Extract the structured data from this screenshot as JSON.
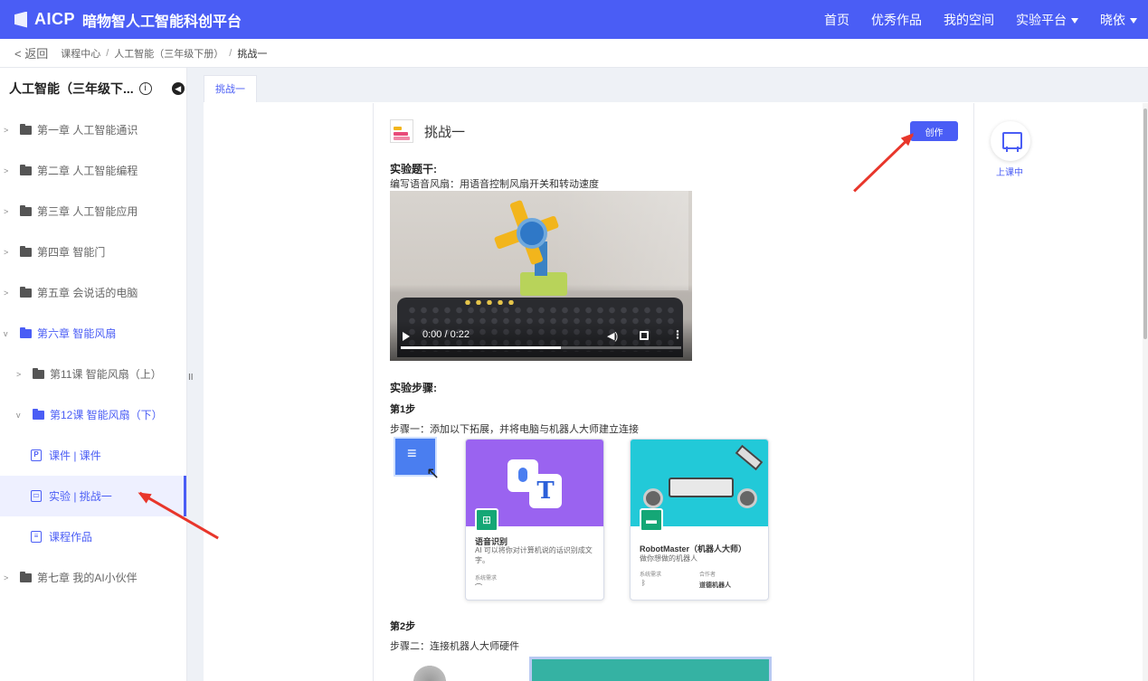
{
  "header": {
    "logo": "AICP",
    "platform_name": "暗物智人工智能科创平台",
    "nav": [
      {
        "label": "首页"
      },
      {
        "label": "优秀作品"
      },
      {
        "label": "我的空间"
      },
      {
        "label": "实验平台",
        "dropdown": true
      },
      {
        "label": "晓依",
        "dropdown": true
      }
    ]
  },
  "breadcrumb": {
    "back": "< 返回",
    "items": [
      "课程中心",
      "人工智能（三年级下册）",
      "挑战一"
    ]
  },
  "sidebar": {
    "title": "人工智能（三年级下...",
    "chapters": [
      {
        "label": "第一章 人工智能通识"
      },
      {
        "label": "第二章 人工智能编程"
      },
      {
        "label": "第三章 人工智能应用"
      },
      {
        "label": "第四章 智能门"
      },
      {
        "label": "第五章 会说话的电脑"
      },
      {
        "label": "第六章 智能风扇"
      }
    ],
    "lessons": [
      {
        "label": "第11课 智能风扇（上）"
      },
      {
        "label": "第12课 智能风扇（下）"
      }
    ],
    "leaves": [
      {
        "label": "课件 | 课件",
        "icon": "P"
      },
      {
        "label": "实验 | 挑战一",
        "icon": "▭"
      },
      {
        "label": "课程作品",
        "icon": "≡"
      }
    ],
    "last_chapter": "第七章 我的AI小伙伴"
  },
  "tabs": [
    {
      "label": "挑战一"
    }
  ],
  "task": {
    "title": "挑战一",
    "create_button": "创作",
    "stem_label": "实验题干:",
    "stem_text": "编写语音风扇：用语音控制风扇开关和转动速度",
    "video": {
      "time": "0:00 / 0:22",
      "progress": 0.57
    },
    "steps_label": "实验步骤:",
    "step1_label": "第1步",
    "step1_text": "步骤一：添加以下拓展，并将电脑与机器人大师建立连接",
    "step2_label": "第2步",
    "step2_text": "步骤二：连接机器人大师硬件",
    "extensions": [
      {
        "name": "语音识别",
        "desc": "AI 可以将你对计算机说的话识别成文字。",
        "meta1_label": "系统需求",
        "meta1_value": "",
        "meta2_label": "",
        "meta2_value": "",
        "banner_color": "#9a63f0"
      },
      {
        "name": "RobotMaster（机器人大师）",
        "desc": "做你想做的机器人",
        "meta1_label": "系统需求",
        "meta1_value": "",
        "meta2_label": "合作者",
        "meta2_value": "道德机器人",
        "banner_color": "#22c9d8"
      }
    ]
  },
  "right_panel": {
    "status": "上课中"
  },
  "colors": {
    "primary": "#4a5df5",
    "annotation": "#e8362b"
  }
}
